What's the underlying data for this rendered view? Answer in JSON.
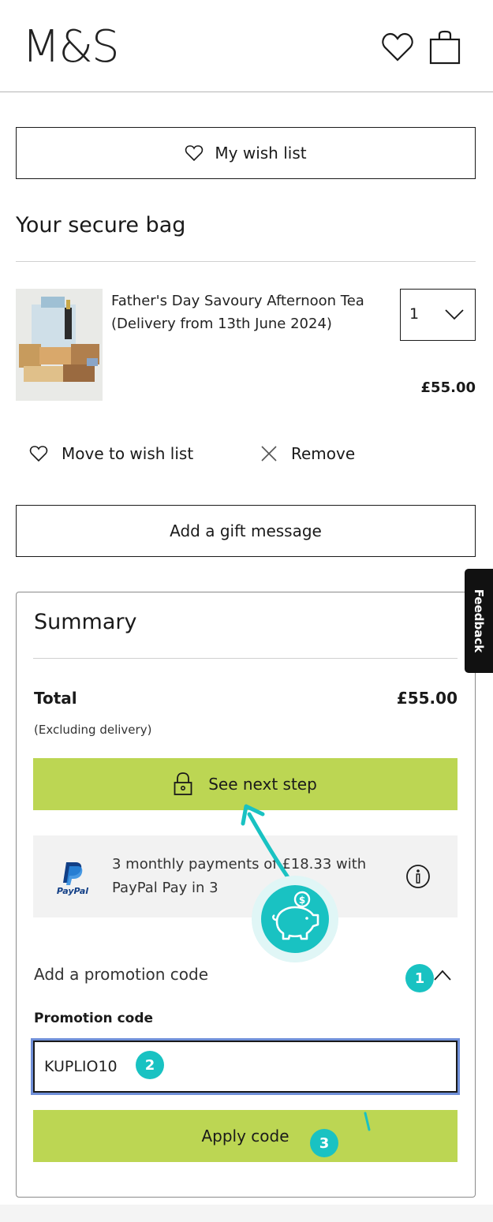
{
  "brand": {
    "logo": "M&S"
  },
  "header": {
    "wishlist_icon": "heart-icon",
    "bag_icon": "shopping-bag-icon"
  },
  "wishlist_button": {
    "label": "My wish list",
    "icon": "heart-icon"
  },
  "bag": {
    "title": "Your secure bag",
    "item": {
      "name": "Father's Day Savoury Afternoon Tea (Delivery from 13th June 2024)",
      "quantity": "1",
      "price": "£55.00"
    },
    "actions": {
      "move_to_wishlist": "Move to wish list",
      "remove": "Remove"
    }
  },
  "gift_message_button": "Add a gift message",
  "summary": {
    "title": "Summary",
    "total_label": "Total",
    "total_value": "£55.00",
    "excluding_note": "(Excluding delivery)",
    "next_step_button": "See next step",
    "paypal": {
      "logo_text": "PayPal",
      "text": "3 monthly payments of £18.33 with PayPal Pay in 3"
    },
    "promo": {
      "header": "Add a promotion code",
      "field_label": "Promotion code",
      "value": "KUPLIO10",
      "apply_button": "Apply code"
    }
  },
  "feedback_tab": "Feedback",
  "annotations": {
    "step1": "1",
    "step2": "2",
    "step3": "3",
    "savings_icon": "piggy-bank-icon",
    "accent_color": "#19c2c2"
  },
  "colors": {
    "green_button": "#bcd653",
    "text": "#1a1a1a"
  }
}
